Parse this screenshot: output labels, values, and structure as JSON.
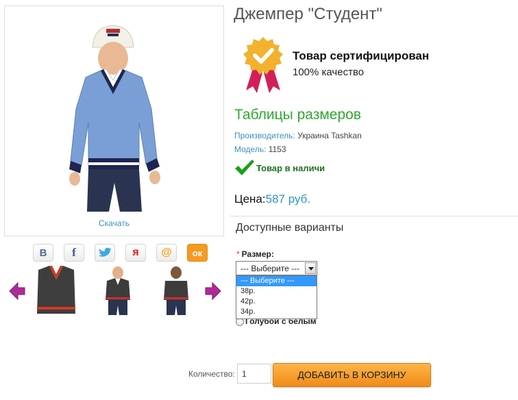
{
  "product": {
    "title": "Джемпер \"Студент\"",
    "download_label": "Скачать",
    "certification": {
      "title": "Товар сертифицирован",
      "subtitle": "100% качество"
    },
    "size_table_link": "Таблицы размеров",
    "manufacturer": {
      "label": "Производитель:",
      "value": "Украина Tashkan"
    },
    "model": {
      "label": "Модель:",
      "value": "1153"
    },
    "stock_status": "Товар в наличи",
    "price": {
      "label": "Цена:",
      "value": "587 руб."
    }
  },
  "share": {
    "buttons": [
      {
        "icon": "vkontakte-icon",
        "glyph": "В"
      },
      {
        "icon": "facebook-icon",
        "glyph": "f"
      },
      {
        "icon": "twitter-icon",
        "glyph": ""
      },
      {
        "icon": "moi-mir-icon",
        "glyph": "я"
      },
      {
        "icon": "mail-ru-icon",
        "glyph": "@"
      },
      {
        "icon": "odnoklassniki-icon",
        "glyph": "ок"
      }
    ]
  },
  "carousel": {
    "prev_icon": "arrow-left-icon",
    "next_icon": "arrow-right-icon",
    "thumbnails": [
      "sweater-flat-thumb",
      "boy-front-thumb",
      "boy-back-thumb"
    ]
  },
  "options": {
    "section_title": "Доступные варианты",
    "size": {
      "label": "Размер:",
      "required_mark": "*",
      "selected": "--- Выберите ---",
      "options": [
        "--- Выберите ---",
        "38р.",
        "42р.",
        "34р."
      ],
      "highlighted_index": 0
    },
    "color": {
      "label": "Голубой с белым"
    }
  },
  "cart": {
    "quantity_label": "Количество:",
    "quantity_value": "1",
    "add_button": "ДОБАВИТЬ В КОРЗИНУ"
  },
  "colors": {
    "link": "#3b8fc4",
    "price": "#2b93c7",
    "green_accent": "#2fa82f",
    "button_orange": "#f49a26",
    "highlight_blue": "#3399ff"
  }
}
